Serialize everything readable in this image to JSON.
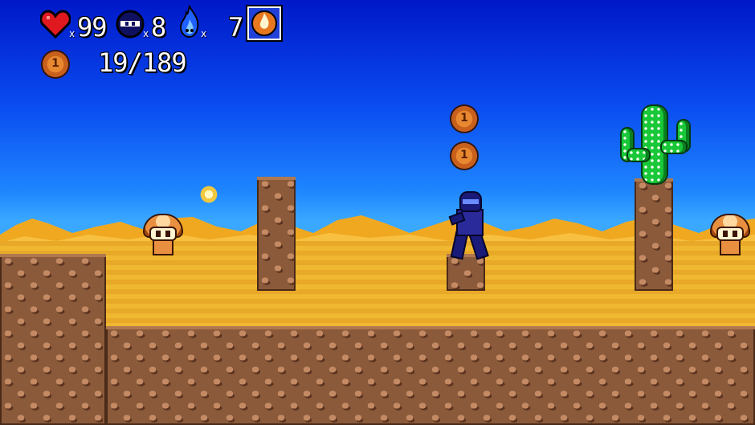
{
  "hud": {
    "health": {
      "icon": "heart-icon",
      "multiplier": "x",
      "value": "99"
    },
    "lives": {
      "icon": "ninja-head-icon",
      "multiplier": "x",
      "value": "8"
    },
    "magic": {
      "icon": "blue-flame-icon",
      "multiplier": "x",
      "value": "7"
    },
    "item": {
      "icon": "fire-orb-item-icon"
    },
    "coins": {
      "icon": "coin-icon",
      "coin_symbol": "1",
      "collected": "19/189"
    }
  },
  "world": {
    "coin_symbol": "1",
    "sky_color": "#1e86ff",
    "sand_color": "#e8a828",
    "rock_color": "#8a5a3a"
  }
}
